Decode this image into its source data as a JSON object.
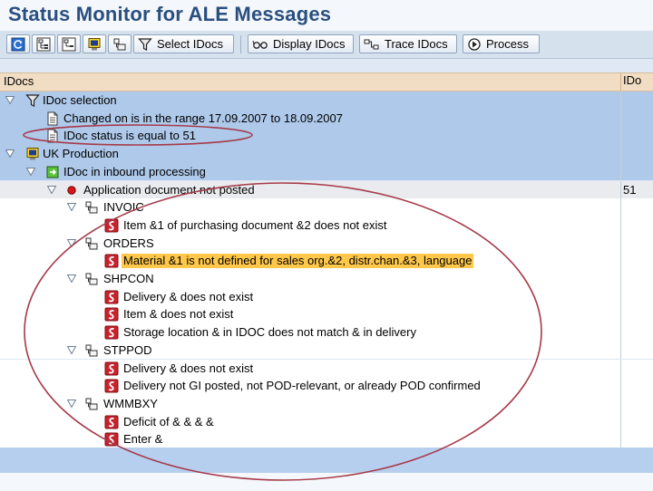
{
  "title": "Status Monitor for ALE Messages",
  "toolbar": {
    "select_idocs": "Select IDocs",
    "display_idocs": "Display IDocs",
    "trace_idocs": "Trace IDocs",
    "process": "Process"
  },
  "columns": {
    "col1": "IDocs",
    "col2": "IDo"
  },
  "tree": {
    "idoc_selection": "IDoc selection",
    "changed_on": "Changed on is in the range 17.09.2007 to 18.09.2007",
    "status_equal": "IDoc status is equal to 51",
    "uk_production": "UK Production",
    "inbound": "IDoc in inbound processing",
    "app_not_posted": "Application document not posted",
    "app_count": "51",
    "invoic": "INVOIC",
    "invoic_msg1": "Item &1 of purchasing document &2 does not exist",
    "orders": "ORDERS",
    "orders_msg1": "Material &1 is not defined for sales org.&2,  distr.chan.&3,  language",
    "shpcon": "SHPCON",
    "shpcon_msg1": "Delivery & does not exist",
    "shpcon_msg2": "Item & does not exist",
    "shpcon_msg3": "Storage location & in IDOC does not match & in delivery",
    "stppod": "STPPOD",
    "stppod_msg1": "Delivery & does not exist",
    "stppod_msg2": "Delivery not GI posted, not POD-relevant, or already POD confirmed",
    "wmmbxy": "WMMBXY",
    "wmmbxy_msg1": "Deficit of & & & &",
    "wmmbxy_msg2": "Enter &"
  }
}
